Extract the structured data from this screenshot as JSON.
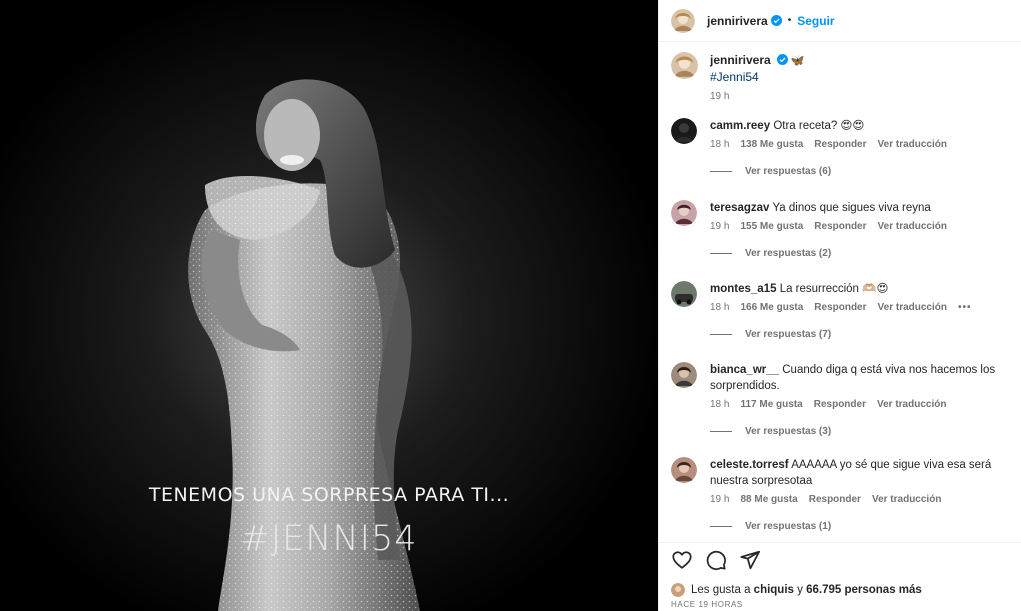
{
  "header": {
    "username": "jennirivera",
    "separator": "•",
    "follow_label": "Seguir"
  },
  "caption": {
    "username": "jennirivera",
    "emoji": "🦋",
    "hashtag": "#Jenni54",
    "time": "19 h"
  },
  "media": {
    "overlay_line1": "TENEMOS UNA SORPRESA PARA TI...",
    "overlay_line2": "#JENNI54"
  },
  "comments": [
    {
      "username": "camm.reey",
      "text": "Otra receta? 😍😍",
      "time": "18 h",
      "likes": "138 Me gusta",
      "reply": "Responder",
      "translate": "Ver traducción",
      "view_replies": "Ver respuestas (6)"
    },
    {
      "username": "teresagzav",
      "text": "Ya dinos que sigues viva reyna",
      "time": "19 h",
      "likes": "155 Me gusta",
      "reply": "Responder",
      "translate": "Ver traducción",
      "view_replies": "Ver respuestas (2)"
    },
    {
      "username": "montes_a15",
      "text": "La resurrección 🫶🏼😍",
      "time": "18 h",
      "likes": "166 Me gusta",
      "reply": "Responder",
      "translate": "Ver traducción",
      "more": "•••",
      "view_replies": "Ver respuestas (7)"
    },
    {
      "username": "bianca_wr__",
      "text": "Cuando diga q está viva nos hacemos los sorprendidos.",
      "time": "18 h",
      "likes": "117 Me gusta",
      "reply": "Responder",
      "translate": "Ver traducción",
      "view_replies": "Ver respuestas (3)"
    },
    {
      "username": "celeste.torresf",
      "text": "AAAAAA yo sé que sigue viva esa será nuestra sorpresotaa",
      "time": "19 h",
      "likes": "88 Me gusta",
      "reply": "Responder",
      "translate": "Ver traducción",
      "view_replies": "Ver respuestas (1)"
    }
  ],
  "likes": {
    "prefix": "Les gusta a",
    "user": "chiquis",
    "joiner": "y",
    "count": "66.795 personas más"
  },
  "posted_ago": "HACE 19 HORAS",
  "icons": [
    "heart-icon",
    "comment-icon",
    "share-icon",
    "verified-icon",
    "more-options-icon"
  ],
  "colors": {
    "accent": "#0095f6",
    "hashtag": "#00376b",
    "muted": "#737373",
    "media_bg": "#000000"
  }
}
